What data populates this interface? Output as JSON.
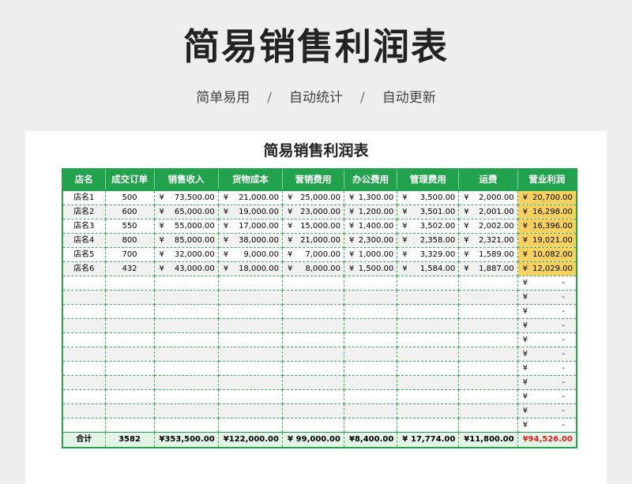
{
  "hero": {
    "title": "简易销售利润表",
    "features": [
      "简单易用",
      "自动统计",
      "自动更新"
    ],
    "separator": "/"
  },
  "sheet": {
    "title": "简易销售利润表",
    "currency": "¥",
    "empty_value": "-",
    "columns": [
      "店名",
      "成交订单",
      "销售收入",
      "货物成本",
      "营销费用",
      "办公费用",
      "管理费用",
      "运费",
      "营业利润"
    ],
    "rows": [
      [
        "店名1",
        "500",
        "73,500.00",
        "21,000.00",
        "25,000.00",
        "1,300.00",
        "3,500.00",
        "2,000.00",
        "20,700.00"
      ],
      [
        "店名2",
        "600",
        "65,000.00",
        "19,000.00",
        "23,000.00",
        "1,200.00",
        "3,501.00",
        "2,001.00",
        "16,298.00"
      ],
      [
        "店名3",
        "550",
        "55,000.00",
        "17,000.00",
        "15,000.00",
        "1,400.00",
        "3,502.00",
        "2,002.00",
        "16,396.00"
      ],
      [
        "店名4",
        "800",
        "85,000.00",
        "38,000.00",
        "21,000.00",
        "2,300.00",
        "2,358.00",
        "2,321.00",
        "19,021.00"
      ],
      [
        "店名5",
        "700",
        "32,000.00",
        "9,000.00",
        "7,000.00",
        "1,000.00",
        "3,329.00",
        "1,589.00",
        "10,082.00"
      ],
      [
        "店名6",
        "432",
        "43,000.00",
        "18,000.00",
        "8,000.00",
        "1,500.00",
        "1,584.00",
        "1,887.00",
        "12,029.00"
      ]
    ],
    "empty_row_count": 11,
    "total": {
      "label": "合计",
      "orders": "3582",
      "sales": "353,500.00",
      "cost": "122,000.00",
      "marketing": "99,000.00",
      "office": "8,400.00",
      "admin": "17,774.00",
      "shipping": "11,800.00",
      "profit": "94,526.00"
    },
    "colors": {
      "header_green": "#23a24d",
      "profit_highlight": "#f6d15e",
      "total_profit_red": "#e02020"
    }
  }
}
